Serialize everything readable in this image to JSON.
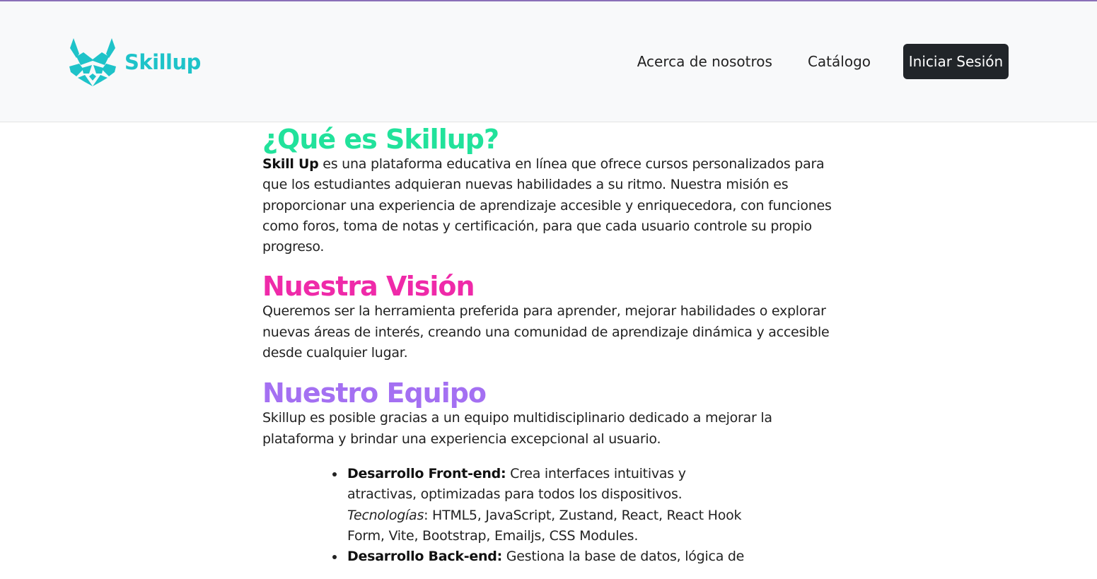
{
  "brand": {
    "name": "Skillup",
    "logo_icon": "horned-mask-logo",
    "color": "#1ec3c9"
  },
  "nav": {
    "about": "Acerca de nosotros",
    "catalog": "Catálogo",
    "login": "Iniciar Sesión"
  },
  "colors": {
    "heading_what": "#21e29b",
    "heading_vision": "#ef2aa9",
    "heading_team": "#a470f2",
    "login_button": "#212529"
  },
  "sections": {
    "what": {
      "title": "¿Qué es Skillup?",
      "lead_bold": "Skill Up",
      "text": " es una plataforma educativa en línea que ofrece cursos personalizados para que los estudiantes adquieran nuevas habilidades a su ritmo. Nuestra misión es proporcionar una experiencia de aprendizaje accesible y enriquecedora, con funciones como foros, toma de notas y certificación, para que cada usuario controle su propio progreso."
    },
    "vision": {
      "title": "Nuestra Visión",
      "text": "Queremos ser la herramienta preferida para aprender, mejorar habilidades o explorar nuevas áreas de interés, creando una comunidad de aprendizaje dinámica y accesible desde cualquier lugar."
    },
    "team": {
      "title": "Nuestro Equipo",
      "text": "Skillup es posible gracias a un equipo multidisciplinario dedicado a mejorar la plataforma y brindar una experiencia excepcional al usuario.",
      "items": [
        {
          "title": "Desarrollo Front-end:",
          "text": " Crea interfaces intuitivas y atractivas, optimizadas para todos los dispositivos.",
          "tech_label": "Tecnologías",
          "tech": ": HTML5, JavaScript, Zustand, React, React Hook Form, Vite, Bootstrap, Emailjs, CSS Modules."
        },
        {
          "title": "Desarrollo Back-end:",
          "text": " Gestiona la base de datos, lógica de"
        }
      ]
    }
  }
}
